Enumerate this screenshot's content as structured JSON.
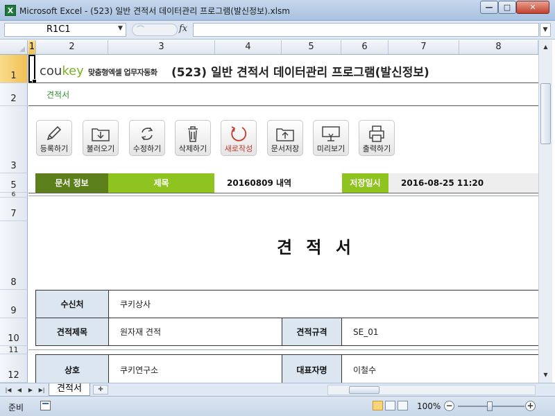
{
  "window": {
    "title": "Microsoft Excel - (523) 일반 견적서 데이터관리 프로그램(발신정보).xlsm",
    "app_icon": "X",
    "minimize": "—",
    "maximize": "□",
    "close": "✕"
  },
  "formula_bar": {
    "name_box": "R1C1",
    "fx": "fx",
    "formula": ""
  },
  "columns": [
    "1",
    "2",
    "3",
    "4",
    "5",
    "6",
    "7",
    "8"
  ],
  "rows": [
    "1",
    "2",
    "3",
    "5",
    "6",
    "7",
    "8",
    "9",
    "10",
    "11",
    "12"
  ],
  "header": {
    "logo_co": "cou",
    "logo_key": "key",
    "logo_tagline": "맞춤형엑셀 업무자동화",
    "title": "(523) 일반 견적서 데이터관리 프로그램(발신정보)",
    "subtitle": "견적서"
  },
  "toolbar": [
    {
      "label": "등록하기",
      "icon": "pencil-icon"
    },
    {
      "label": "불러오기",
      "icon": "folder-download-icon"
    },
    {
      "label": "수정하기",
      "icon": "refresh-icon"
    },
    {
      "label": "삭제하기",
      "icon": "trash-icon"
    },
    {
      "label": "새로작성",
      "icon": "new-circle-icon"
    },
    {
      "label": "문서저장",
      "icon": "folder-upload-icon"
    },
    {
      "label": "미리보기",
      "icon": "monitor-icon"
    },
    {
      "label": "출력하기",
      "icon": "printer-icon"
    }
  ],
  "info_band": {
    "doc_info_label": "문서 정보",
    "title_label": "제목",
    "title_value": "20160809 내역",
    "saved_label": "저장일시",
    "saved_value": "2016-08-25 11:20"
  },
  "document": {
    "title": "견 적 서"
  },
  "form": {
    "recipient_label": "수신처",
    "recipient_value": "쿠키상사",
    "quote_title_label": "견적제목",
    "quote_title_value": "원자재 견적",
    "quote_spec_label": "견적규격",
    "quote_spec_value": "SE_01",
    "company_label": "상호",
    "company_value": "쿠키연구소",
    "ceo_label": "대표자명",
    "ceo_value": "이철수"
  },
  "sheet_tabs": {
    "active": "견적서",
    "new_tab_icon": "new-sheet-icon"
  },
  "status": {
    "ready": "준비",
    "zoom": "100%",
    "zoom_minus": "−",
    "zoom_plus": "+"
  },
  "colors": {
    "doc_info_green": "#5b7f1a",
    "accent_green": "#8fc31f",
    "label_blue": "#dce6f1",
    "new_red": "#c0392b"
  }
}
